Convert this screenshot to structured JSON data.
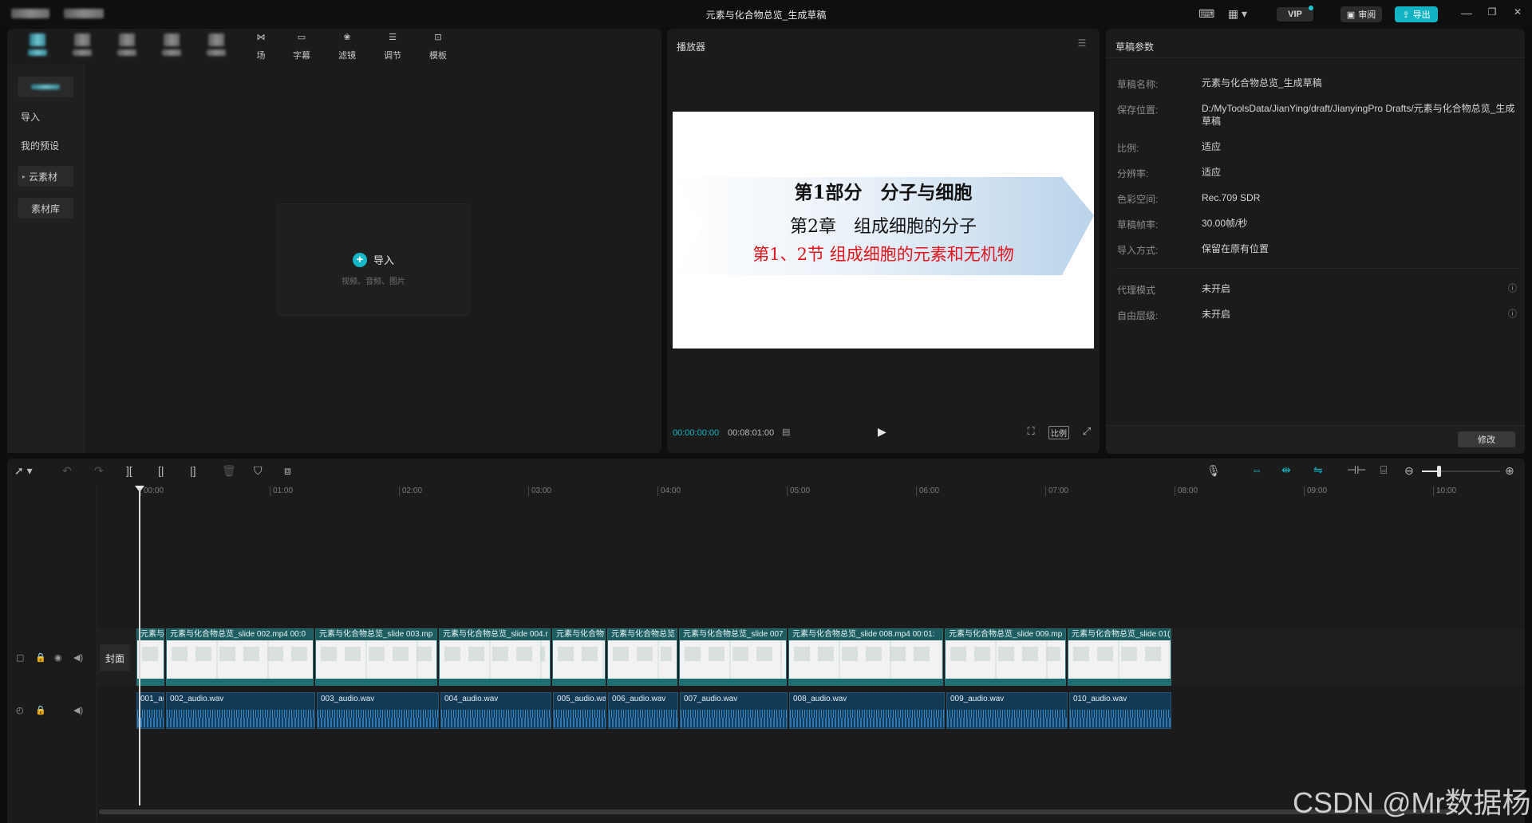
{
  "window": {
    "title": "元素与化合物总览_生成草稿",
    "vip_label": "VIP",
    "review_label": "审阅",
    "export_label": "导出",
    "minimize_icon": "—",
    "restore_icon": "❐",
    "close_icon": "✕"
  },
  "media_toolbar": {
    "tabs": [
      {
        "label": "字幕",
        "icon": "caption-icon"
      },
      {
        "label": "滤镜",
        "icon": "filter-icon"
      },
      {
        "label": "调节",
        "icon": "adjust-icon"
      },
      {
        "label": "模板",
        "icon": "template-icon"
      }
    ],
    "partial_label": "场"
  },
  "left_nav": {
    "items": [
      "导入",
      "我的预设",
      "云素材",
      "素材库"
    ]
  },
  "import_box": {
    "label": "导入",
    "hint": "视频、音频、图片"
  },
  "player": {
    "title": "播放器",
    "slide": {
      "line1": "第1部分　分子与细胞",
      "line2": "第2章　组成细胞的分子",
      "line3": "第1、2节 组成细胞的元素和无机物"
    },
    "current_time": "00:00:00:00",
    "total_time": "00:08:01:00",
    "ratio_label": "比例"
  },
  "draft_params": {
    "title": "草稿参数",
    "rows": [
      {
        "label": "草稿名称:",
        "value": "元素与化合物总览_生成草稿"
      },
      {
        "label": "保存位置:",
        "value": "D:/MyToolsData/JianYing/draft/JianyingPro Drafts/元素与化合物总览_生成草稿"
      },
      {
        "label": "比例:",
        "value": "适应"
      },
      {
        "label": "分辨率:",
        "value": "适应"
      },
      {
        "label": "色彩空间:",
        "value": "Rec.709 SDR"
      },
      {
        "label": "草稿帧率:",
        "value": "30.00帧/秒"
      },
      {
        "label": "导入方式:",
        "value": "保留在原有位置"
      },
      {
        "label": "代理模式",
        "value": "未开启"
      },
      {
        "label": "自由层级:",
        "value": "未开启"
      }
    ],
    "modify_label": "修改"
  },
  "timeline": {
    "ticks": [
      "00:00",
      "01:00",
      "02:00",
      "03:00",
      "04:00",
      "05:00",
      "06:00",
      "07:00",
      "08:00",
      "09:00",
      "10:00"
    ],
    "cover_label": "封面",
    "video_clips": [
      {
        "label": "元素与"
      },
      {
        "label": "元素与化合物总览_slide 002.mp4  00:0"
      },
      {
        "label": "元素与化合物总览_slide 003.mp"
      },
      {
        "label": "元素与化合物总览_slide 004.r"
      },
      {
        "label": "元素与化合物"
      },
      {
        "label": "元素与化合物总览"
      },
      {
        "label": "元素与化合物总览_slide 007"
      },
      {
        "label": "元素与化合物总览_slide 008.mp4  00:01:"
      },
      {
        "label": "元素与化合物总览_slide 009.mp"
      },
      {
        "label": "元素与化合物总览_slide 01("
      }
    ],
    "audio_clips": [
      {
        "label": "001_au"
      },
      {
        "label": "002_audio.wav"
      },
      {
        "label": "003_audio.wav"
      },
      {
        "label": "004_audio.wav"
      },
      {
        "label": "005_audio.wa"
      },
      {
        "label": "006_audio.wav"
      },
      {
        "label": "007_audio.wav"
      },
      {
        "label": "008_audio.wav"
      },
      {
        "label": "009_audio.wav"
      },
      {
        "label": "010_audio.wav"
      }
    ]
  },
  "watermark": "CSDN @Mr数据杨"
}
